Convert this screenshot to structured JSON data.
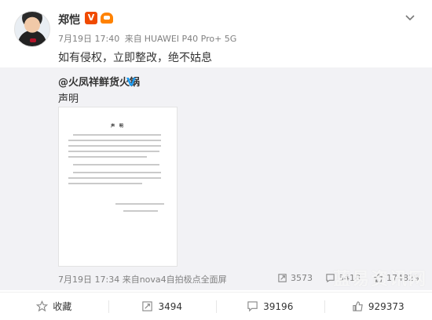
{
  "post": {
    "author": "郑恺",
    "verified_badge": "V",
    "badges": [
      "vip-verified-icon",
      "member-crown-icon"
    ],
    "time": "7月19日 17:40",
    "source_prefix": "来自",
    "source": "HUAWEI P40 Pro+ 5G",
    "text": "如有侵权，立即整改，绝不姑息"
  },
  "repost": {
    "user": "@火凤祥鲜货火锅",
    "text": "声明",
    "doc_title": "声 明",
    "time": "7月19日 17:34",
    "source_prefix": "来自",
    "source": "nova4自拍极点全面屏",
    "stats": {
      "forward": "3573",
      "comment": "5418",
      "like": "174829"
    }
  },
  "actions": {
    "favorite": "收藏",
    "forward": "3494",
    "comment": "39196",
    "like": "929373"
  },
  "watermark": "蓝易资讯网",
  "colors": {
    "accent": "#ff8200",
    "vip": "#f04a00",
    "verified_blue": "#1d9bf0",
    "meta_gray": "#808080",
    "repost_bg": "#f2f2f5"
  }
}
